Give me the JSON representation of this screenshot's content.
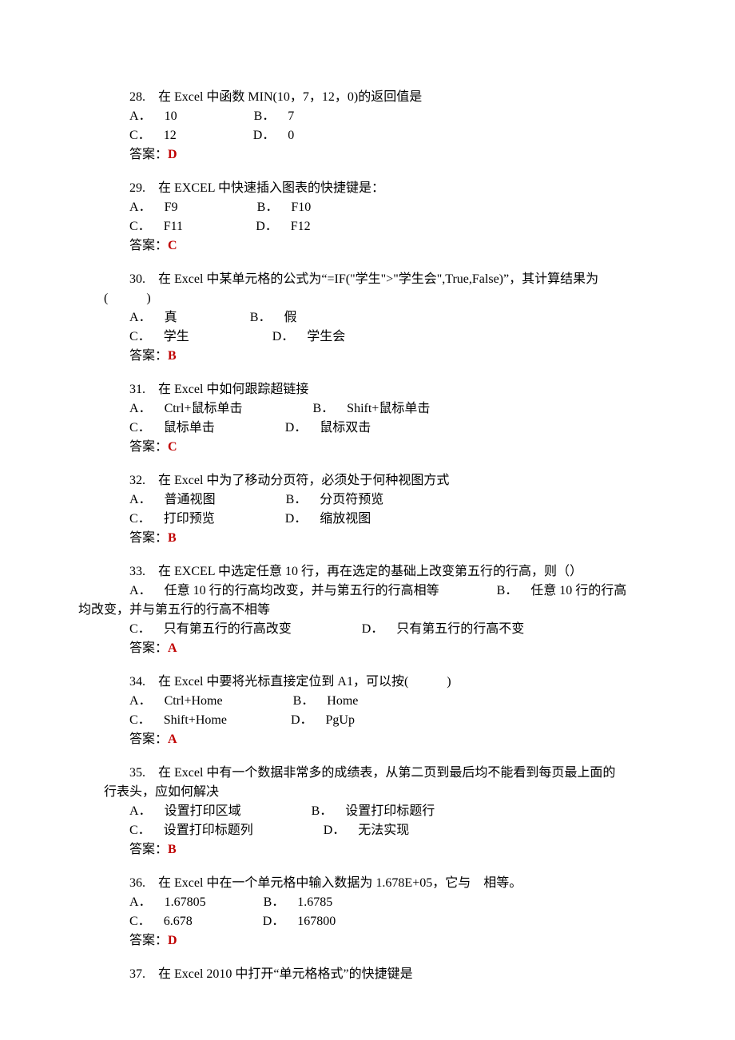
{
  "questions": [
    {
      "num": "28.",
      "text": "在 Excel 中函数 MIN(10，7，12，0)的返回值是",
      "optA_label": "A．",
      "optA": "10",
      "optB_label": "B．",
      "optB": "7",
      "optC_label": "C．",
      "optC": "12",
      "optD_label": "D．",
      "optD": "0",
      "answer_label": "答案：",
      "answer": "D"
    },
    {
      "num": "29.",
      "text": "在 EXCEL 中快速插入图表的快捷键是：",
      "optA_label": "A．",
      "optA": "F9",
      "optB_label": "B．",
      "optB": "F10",
      "optC_label": "C．",
      "optC": "F11",
      "optD_label": "D．",
      "optD": "F12",
      "answer_label": "答案：",
      "answer": "C"
    },
    {
      "num": "30.",
      "text_prefix": "在 Excel 中某单元格的公式为“=IF(\"学生\">\"学生会\",True,False)”，其计算结果为",
      "text_suffix": "(　　　)",
      "optA_label": "A．",
      "optA": "真",
      "optB_label": "B．",
      "optB": "假",
      "optC_label": "C．",
      "optC": "学生",
      "optD_label": "D．",
      "optD": "学生会",
      "answer_label": "答案：",
      "answer": "B"
    },
    {
      "num": "31.",
      "text": "在 Excel 中如何跟踪超链接",
      "optA_label": "A．",
      "optA": "Ctrl+鼠标单击",
      "optB_label": "B．",
      "optB": "Shift+鼠标单击",
      "optC_label": "C．",
      "optC": "鼠标单击",
      "optD_label": "D．",
      "optD": "鼠标双击",
      "answer_label": "答案：",
      "answer": "C"
    },
    {
      "num": "32.",
      "text": "在 Excel 中为了移动分页符，必须处于何种视图方式",
      "optA_label": "A．",
      "optA": "普通视图",
      "optB_label": "B．",
      "optB": "分页符预览",
      "optC_label": "C．",
      "optC": "打印预览",
      "optD_label": "D．",
      "optD": "缩放视图",
      "answer_label": "答案：",
      "answer": "B"
    },
    {
      "num": "33.",
      "text": "在 EXCEL 中选定任意 10 行，再在选定的基础上改变第五行的行高，则（）",
      "optA_label": "A．",
      "optA": "任意 10 行的行高均改变，并与第五行的行高相等",
      "optB_label": "B．",
      "optB_prefix": "任意 10 行的行高",
      "optB_wrap": "均改变，并与第五行的行高不相等",
      "optC_label": "C．",
      "optC": "只有第五行的行高改变",
      "optD_label": "D．",
      "optD": "只有第五行的行高不变",
      "answer_label": "答案：",
      "answer": "A"
    },
    {
      "num": "34.",
      "text": "在 Excel 中要将光标直接定位到 A1，可以按(　　　)",
      "optA_label": "A．",
      "optA": "Ctrl+Home",
      "optB_label": "B．",
      "optB": "Home",
      "optC_label": "C．",
      "optC": "Shift+Home",
      "optD_label": "D．",
      "optD": "PgUp",
      "answer_label": "答案：",
      "answer": "A"
    },
    {
      "num": "35.",
      "text_prefix": "在 Excel 中有一个数据非常多的成绩表，从第二页到最后均不能看到每页最上面的",
      "text_suffix": "行表头，应如何解决",
      "optA_label": "A．",
      "optA": "设置打印区域",
      "optB_label": "B．",
      "optB": "设置打印标题行",
      "optC_label": "C．",
      "optC": "设置打印标题列",
      "optD_label": "D．",
      "optD": "无法实现",
      "answer_label": "答案：",
      "answer": "B"
    },
    {
      "num": "36.",
      "text": "在 Excel 中在一个单元格中输入数据为 1.678E+05，它与　相等。",
      "optA_label": "A．",
      "optA": "1.67805",
      "optB_label": "B．",
      "optB": "1.6785",
      "optC_label": "C．",
      "optC": "6.678",
      "optD_label": "D．",
      "optD": "167800",
      "answer_label": "答案：",
      "answer": "D"
    },
    {
      "num": "37.",
      "text": "在 Excel 2010 中打开“单元格格式”的快捷键是"
    }
  ]
}
